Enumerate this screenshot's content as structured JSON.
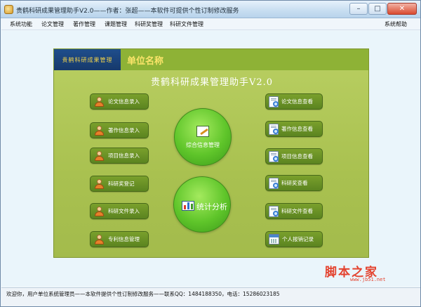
{
  "window": {
    "title": "贵鹤科研成果管理助手V2.0——作者：张超——本软件可提供个性订制修改服务",
    "buttons": {
      "minimize": "–",
      "maximize": "□",
      "close": "✕"
    }
  },
  "menu": {
    "items": [
      "系统功能",
      "论文管理",
      "著作管理",
      "课题管理",
      "科研奖管理",
      "科研文件管理"
    ],
    "help": "系统帮助"
  },
  "banner": {
    "logo_text": "贵鹤科研成果管理",
    "org_name": "单位名称"
  },
  "app_heading": "贵鹤科研成果管理助手V2.0",
  "left_buttons": [
    {
      "label": "论文信息录入",
      "icon": "person-icon"
    },
    {
      "label": "著作信息录入",
      "icon": "person-icon"
    },
    {
      "label": "项目信息录入",
      "icon": "person-icon"
    },
    {
      "label": "科研奖登记",
      "icon": "person-icon"
    },
    {
      "label": "科研文件录入",
      "icon": "person-icon"
    },
    {
      "label": "专利信息管理",
      "icon": "person-icon"
    }
  ],
  "right_buttons": [
    {
      "label": "论文信息查看",
      "icon": "document-search-icon"
    },
    {
      "label": "著作信息查看",
      "icon": "document-search-icon"
    },
    {
      "label": "项目信息查看",
      "icon": "document-search-icon"
    },
    {
      "label": "科研奖查看",
      "icon": "document-search-icon"
    },
    {
      "label": "科研文件查看",
      "icon": "document-search-icon"
    },
    {
      "label": "个人报销记录",
      "icon": "calendar-icon"
    }
  ],
  "center": {
    "top_circle_label": "综合信息管理",
    "bottom_circle_label": "统计分析"
  },
  "watermark": {
    "main": "脚本之家",
    "sub": "www.jb51.net"
  },
  "status": {
    "text": "欢迎你，用户单位系统管理员——本软件提供个性订制修改服务——联系QQ：1484188350，电话：15286023185"
  },
  "colors": {
    "panel_green": "#a9c150",
    "button_green": "#6b9226",
    "circle_green": "#5fc52a",
    "banner_blue": "#1f4e8c",
    "org_name_yellow": "#fbe46a",
    "watermark_red": "#e4432f"
  }
}
